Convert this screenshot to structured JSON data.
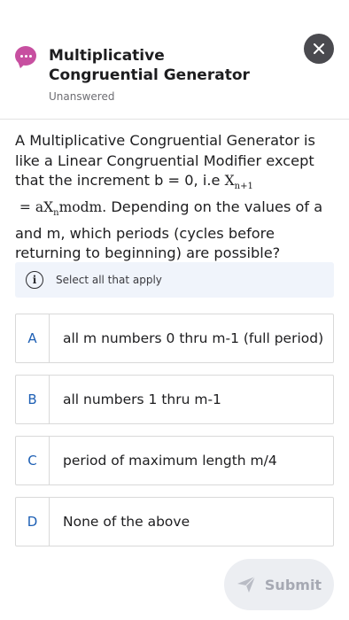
{
  "header": {
    "title": "Multiplicative Congruential Generator",
    "status": "Unanswered",
    "chat_icon": "chat-bubble-icon",
    "close_icon": "close-icon"
  },
  "question": {
    "part1": "A Multiplicative Congruential Generator is like a Linear Congruential Modifier except that the increment b = 0, i.e ",
    "formula": {
      "lhs_base": "X",
      "lhs_sub": "n+1",
      "eq": " = ",
      "rhs_coef": "a",
      "rhs_base": "X",
      "rhs_sub": "n",
      "rhs_rest": "modm",
      "end": "."
    },
    "part2": " Depending on the values of a and m, which periods (cycles before returning to beginning) are possible?"
  },
  "hint": {
    "icon": "info-icon",
    "text": "Select all that apply"
  },
  "options": [
    {
      "letter": "A",
      "text": "all m numbers 0 thru m-1 (full period)"
    },
    {
      "letter": "B",
      "text": "all numbers 1 thru m-1"
    },
    {
      "letter": "C",
      "text": "period of maximum length m/4"
    },
    {
      "letter": "D",
      "text": "None of the above"
    }
  ],
  "submit": {
    "label": "Submit",
    "icon": "send-icon"
  },
  "colors": {
    "bubble": "#c74fa0",
    "close_bg": "#4a4a4f",
    "letter": "#1d5fb4",
    "hint_bg": "#f0f4fb",
    "submit_bg": "#eceef2",
    "submit_text": "#a6a9b3"
  }
}
